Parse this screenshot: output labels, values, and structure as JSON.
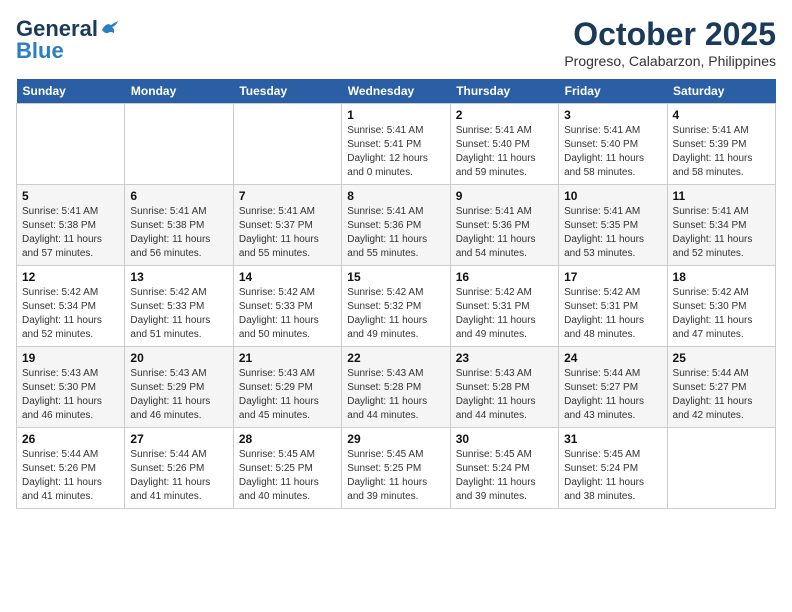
{
  "logo": {
    "line1": "General",
    "line2": "Blue"
  },
  "title": "October 2025",
  "location": "Progreso, Calabarzon, Philippines",
  "days_of_week": [
    "Sunday",
    "Monday",
    "Tuesday",
    "Wednesday",
    "Thursday",
    "Friday",
    "Saturday"
  ],
  "weeks": [
    [
      {
        "day": "",
        "sunrise": "",
        "sunset": "",
        "daylight": ""
      },
      {
        "day": "",
        "sunrise": "",
        "sunset": "",
        "daylight": ""
      },
      {
        "day": "",
        "sunrise": "",
        "sunset": "",
        "daylight": ""
      },
      {
        "day": "1",
        "sunrise": "Sunrise: 5:41 AM",
        "sunset": "Sunset: 5:41 PM",
        "daylight": "Daylight: 12 hours and 0 minutes."
      },
      {
        "day": "2",
        "sunrise": "Sunrise: 5:41 AM",
        "sunset": "Sunset: 5:40 PM",
        "daylight": "Daylight: 11 hours and 59 minutes."
      },
      {
        "day": "3",
        "sunrise": "Sunrise: 5:41 AM",
        "sunset": "Sunset: 5:40 PM",
        "daylight": "Daylight: 11 hours and 58 minutes."
      },
      {
        "day": "4",
        "sunrise": "Sunrise: 5:41 AM",
        "sunset": "Sunset: 5:39 PM",
        "daylight": "Daylight: 11 hours and 58 minutes."
      }
    ],
    [
      {
        "day": "5",
        "sunrise": "Sunrise: 5:41 AM",
        "sunset": "Sunset: 5:38 PM",
        "daylight": "Daylight: 11 hours and 57 minutes."
      },
      {
        "day": "6",
        "sunrise": "Sunrise: 5:41 AM",
        "sunset": "Sunset: 5:38 PM",
        "daylight": "Daylight: 11 hours and 56 minutes."
      },
      {
        "day": "7",
        "sunrise": "Sunrise: 5:41 AM",
        "sunset": "Sunset: 5:37 PM",
        "daylight": "Daylight: 11 hours and 55 minutes."
      },
      {
        "day": "8",
        "sunrise": "Sunrise: 5:41 AM",
        "sunset": "Sunset: 5:36 PM",
        "daylight": "Daylight: 11 hours and 55 minutes."
      },
      {
        "day": "9",
        "sunrise": "Sunrise: 5:41 AM",
        "sunset": "Sunset: 5:36 PM",
        "daylight": "Daylight: 11 hours and 54 minutes."
      },
      {
        "day": "10",
        "sunrise": "Sunrise: 5:41 AM",
        "sunset": "Sunset: 5:35 PM",
        "daylight": "Daylight: 11 hours and 53 minutes."
      },
      {
        "day": "11",
        "sunrise": "Sunrise: 5:41 AM",
        "sunset": "Sunset: 5:34 PM",
        "daylight": "Daylight: 11 hours and 52 minutes."
      }
    ],
    [
      {
        "day": "12",
        "sunrise": "Sunrise: 5:42 AM",
        "sunset": "Sunset: 5:34 PM",
        "daylight": "Daylight: 11 hours and 52 minutes."
      },
      {
        "day": "13",
        "sunrise": "Sunrise: 5:42 AM",
        "sunset": "Sunset: 5:33 PM",
        "daylight": "Daylight: 11 hours and 51 minutes."
      },
      {
        "day": "14",
        "sunrise": "Sunrise: 5:42 AM",
        "sunset": "Sunset: 5:33 PM",
        "daylight": "Daylight: 11 hours and 50 minutes."
      },
      {
        "day": "15",
        "sunrise": "Sunrise: 5:42 AM",
        "sunset": "Sunset: 5:32 PM",
        "daylight": "Daylight: 11 hours and 49 minutes."
      },
      {
        "day": "16",
        "sunrise": "Sunrise: 5:42 AM",
        "sunset": "Sunset: 5:31 PM",
        "daylight": "Daylight: 11 hours and 49 minutes."
      },
      {
        "day": "17",
        "sunrise": "Sunrise: 5:42 AM",
        "sunset": "Sunset: 5:31 PM",
        "daylight": "Daylight: 11 hours and 48 minutes."
      },
      {
        "day": "18",
        "sunrise": "Sunrise: 5:42 AM",
        "sunset": "Sunset: 5:30 PM",
        "daylight": "Daylight: 11 hours and 47 minutes."
      }
    ],
    [
      {
        "day": "19",
        "sunrise": "Sunrise: 5:43 AM",
        "sunset": "Sunset: 5:30 PM",
        "daylight": "Daylight: 11 hours and 46 minutes."
      },
      {
        "day": "20",
        "sunrise": "Sunrise: 5:43 AM",
        "sunset": "Sunset: 5:29 PM",
        "daylight": "Daylight: 11 hours and 46 minutes."
      },
      {
        "day": "21",
        "sunrise": "Sunrise: 5:43 AM",
        "sunset": "Sunset: 5:29 PM",
        "daylight": "Daylight: 11 hours and 45 minutes."
      },
      {
        "day": "22",
        "sunrise": "Sunrise: 5:43 AM",
        "sunset": "Sunset: 5:28 PM",
        "daylight": "Daylight: 11 hours and 44 minutes."
      },
      {
        "day": "23",
        "sunrise": "Sunrise: 5:43 AM",
        "sunset": "Sunset: 5:28 PM",
        "daylight": "Daylight: 11 hours and 44 minutes."
      },
      {
        "day": "24",
        "sunrise": "Sunrise: 5:44 AM",
        "sunset": "Sunset: 5:27 PM",
        "daylight": "Daylight: 11 hours and 43 minutes."
      },
      {
        "day": "25",
        "sunrise": "Sunrise: 5:44 AM",
        "sunset": "Sunset: 5:27 PM",
        "daylight": "Daylight: 11 hours and 42 minutes."
      }
    ],
    [
      {
        "day": "26",
        "sunrise": "Sunrise: 5:44 AM",
        "sunset": "Sunset: 5:26 PM",
        "daylight": "Daylight: 11 hours and 41 minutes."
      },
      {
        "day": "27",
        "sunrise": "Sunrise: 5:44 AM",
        "sunset": "Sunset: 5:26 PM",
        "daylight": "Daylight: 11 hours and 41 minutes."
      },
      {
        "day": "28",
        "sunrise": "Sunrise: 5:45 AM",
        "sunset": "Sunset: 5:25 PM",
        "daylight": "Daylight: 11 hours and 40 minutes."
      },
      {
        "day": "29",
        "sunrise": "Sunrise: 5:45 AM",
        "sunset": "Sunset: 5:25 PM",
        "daylight": "Daylight: 11 hours and 39 minutes."
      },
      {
        "day": "30",
        "sunrise": "Sunrise: 5:45 AM",
        "sunset": "Sunset: 5:24 PM",
        "daylight": "Daylight: 11 hours and 39 minutes."
      },
      {
        "day": "31",
        "sunrise": "Sunrise: 5:45 AM",
        "sunset": "Sunset: 5:24 PM",
        "daylight": "Daylight: 11 hours and 38 minutes."
      },
      {
        "day": "",
        "sunrise": "",
        "sunset": "",
        "daylight": ""
      }
    ]
  ]
}
